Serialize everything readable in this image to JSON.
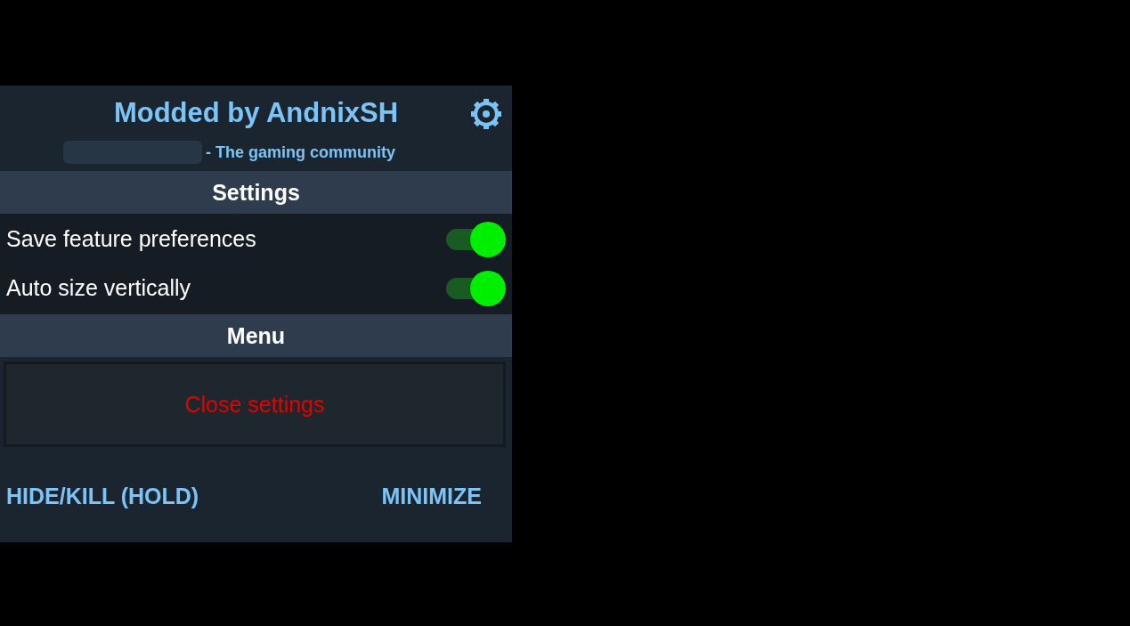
{
  "header": {
    "title": "Modded by AndnixSH",
    "subtitle": "- The gaming community"
  },
  "sections": [
    {
      "title": "Settings",
      "items": [
        {
          "kind": "switch",
          "label": "Save feature preferences",
          "on": true
        },
        {
          "kind": "switch",
          "label": "Auto size vertically",
          "on": true
        }
      ]
    },
    {
      "title": "Menu",
      "items": [
        {
          "kind": "button",
          "label": "Close settings"
        }
      ]
    }
  ],
  "footer": {
    "buttons": [
      "HIDE/KILL (HOLD)",
      "MINIMIZE"
    ]
  }
}
